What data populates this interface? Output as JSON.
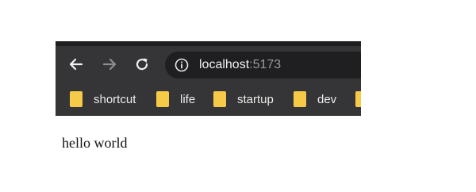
{
  "browser": {
    "nav": {
      "back_icon": "arrow-left-icon",
      "forward_icon": "arrow-right-icon",
      "reload_icon": "reload-icon"
    },
    "address_bar": {
      "security_icon": "info-icon",
      "host": "localhost",
      "port": ":5173"
    },
    "bookmarks": [
      {
        "label": "shortcut",
        "icon": "folder-icon"
      },
      {
        "label": "life",
        "icon": "folder-icon"
      },
      {
        "label": "startup",
        "icon": "folder-icon"
      },
      {
        "label": "dev",
        "icon": "folder-icon"
      }
    ],
    "colors": {
      "toolbar": "#353537",
      "omnibox": "#1f1f21",
      "folder": "#f7c948"
    }
  },
  "page": {
    "body_text": "hello world"
  }
}
